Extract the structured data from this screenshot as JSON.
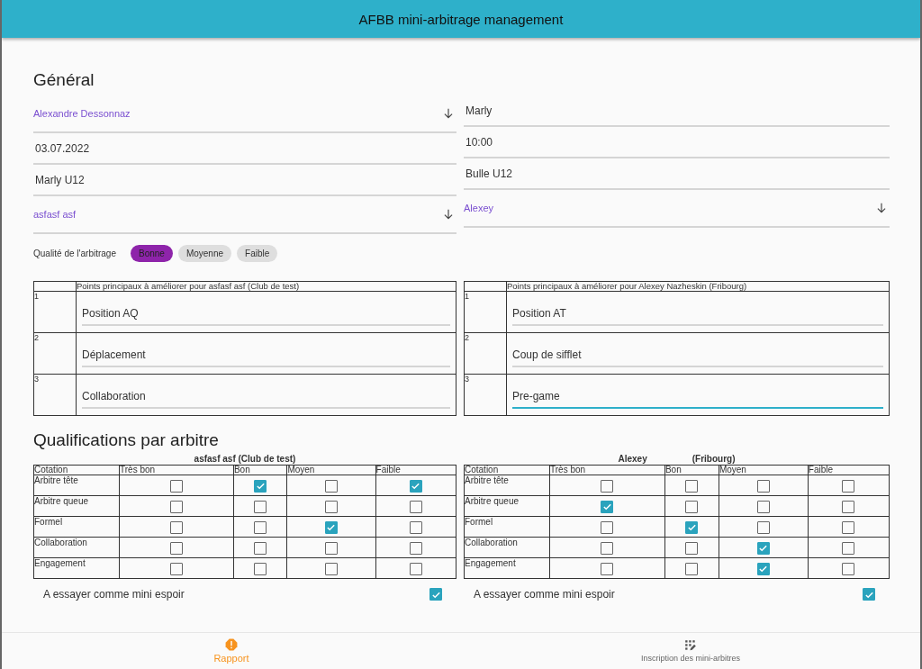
{
  "header": {
    "title": "AFBB mini-arbitrage management"
  },
  "general": {
    "title": "Général",
    "left_fields": [
      {
        "kind": "select",
        "value": "Alexandre Dessonnaz"
      },
      {
        "kind": "text",
        "value": "03.07.2022"
      },
      {
        "kind": "text",
        "value": "Marly U12"
      },
      {
        "kind": "select",
        "value": "asfasf asf"
      }
    ],
    "right_fields": [
      {
        "kind": "text",
        "value": "Marly"
      },
      {
        "kind": "text",
        "value": "10:00"
      },
      {
        "kind": "text",
        "value": "Bulle U12"
      },
      {
        "kind": "select",
        "value": "Alexey"
      }
    ],
    "quality": {
      "label": "Qualité de l'arbitrage",
      "options": [
        {
          "label": "Bonne",
          "selected": true
        },
        {
          "label": "Moyenne",
          "selected": false
        },
        {
          "label": "Faible",
          "selected": false
        }
      ]
    }
  },
  "improvement_tables": [
    {
      "heading": "Points principaux à améliorer pour asfasf asf (Club de test)",
      "rows": [
        {
          "number": "1",
          "value": "Position AQ",
          "focused": false
        },
        {
          "number": "2",
          "value": "Déplacement",
          "focused": false
        },
        {
          "number": "3",
          "value": "Collaboration",
          "focused": false
        }
      ]
    },
    {
      "heading": "Points principaux à améliorer pour Alexey Nazheskin (Fribourg)",
      "rows": [
        {
          "number": "1",
          "value": "Position AT",
          "focused": false
        },
        {
          "number": "2",
          "value": "Coup de sifflet",
          "focused": false
        },
        {
          "number": "3",
          "value": "Pre-game",
          "focused": true
        }
      ]
    }
  ],
  "qualifications": {
    "title": "Qualifications par arbitre",
    "tables": [
      {
        "heading": [
          "asfasf asf (Club de test)"
        ],
        "columns": [
          "Cotation",
          "Très bon",
          "Bon",
          "Moyen",
          "Faible"
        ],
        "rows": [
          {
            "label": "Arbitre tête",
            "checks": [
              false,
              true,
              false,
              true
            ]
          },
          {
            "label": "Arbitre queue",
            "checks": [
              false,
              false,
              false,
              false
            ]
          },
          {
            "label": "Formel",
            "checks": [
              false,
              false,
              true,
              false
            ]
          },
          {
            "label": "Collaboration",
            "checks": [
              false,
              false,
              false,
              false
            ]
          },
          {
            "label": "Engagement",
            "checks": [
              false,
              false,
              false,
              false
            ]
          }
        ],
        "espoir": {
          "label": "A essayer comme mini espoir",
          "checked": true
        }
      },
      {
        "heading": [
          "Alexey",
          "(Fribourg)"
        ],
        "columns": [
          "Cotation",
          "Très bon",
          "Bon",
          "Moyen",
          "Faible"
        ],
        "rows": [
          {
            "label": "Arbitre tête",
            "checks": [
              false,
              false,
              false,
              false
            ]
          },
          {
            "label": "Arbitre queue",
            "checks": [
              true,
              false,
              false,
              false
            ]
          },
          {
            "label": "Formel",
            "checks": [
              false,
              true,
              false,
              false
            ]
          },
          {
            "label": "Collaboration",
            "checks": [
              false,
              false,
              true,
              false
            ]
          },
          {
            "label": "Engagement",
            "checks": [
              false,
              false,
              true,
              false
            ]
          }
        ],
        "espoir": {
          "label": "A essayer comme mini espoir",
          "checked": true
        }
      }
    ]
  },
  "bottom_nav": [
    {
      "kind": "alert",
      "label": "Rapport",
      "selected": true
    },
    {
      "kind": "grid",
      "label": "Inscription des mini-arbitres",
      "selected": false
    }
  ]
}
